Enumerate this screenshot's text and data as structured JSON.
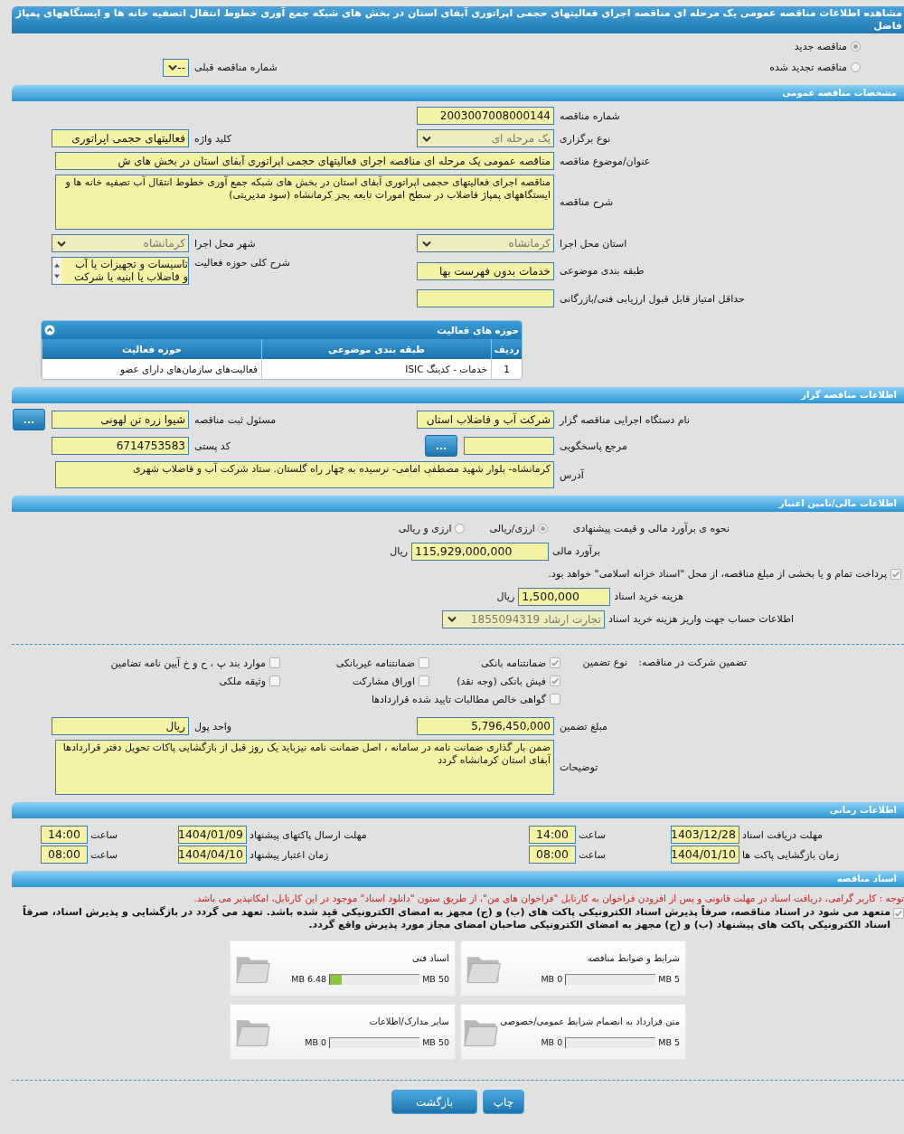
{
  "page_title": "مشاهده اطلاعات مناقصه عمومی یک مرحله ای مناقصه اجرای فعالیتهای حجمی اپراتوری آبفای استان در بخش های شبکه جمع آوری خطوط انتقال اتصفیه خانه ها و ایستگاههای پمپاژ فاضل",
  "tender_kind": [
    {
      "label": "مناقصه جدید",
      "selected": true
    },
    {
      "label": "مناقصه تجدید شده",
      "selected": false
    }
  ],
  "previous_tender": {
    "label": "شماره مناقصه قبلی",
    "value": "--",
    "kind": "select",
    "disabled": false
  },
  "general": {
    "title": "مشخصات مناقصه عمومی",
    "rows": [
      [
        {
          "label": "شماره مناقصه",
          "value": "2003007008000144",
          "kind": "text"
        }
      ],
      [
        {
          "label": "نوع برگزاری",
          "value": "یک مرحله ای",
          "kind": "select",
          "disabled": true
        },
        {
          "label": "کلید واژه",
          "value": "فعالیتهای حجمی اپراتوری",
          "kind": "text"
        }
      ],
      [
        {
          "label": "عنوان/موضوع مناقصه",
          "value": "مناقصه عمومی یک مرحله ای مناقصه اجرای فعالیتهای حجمی اپراتوری آبفای استان  در بخش های ش",
          "kind": "line"
        }
      ],
      [
        {
          "label": "شرح مناقصه",
          "value": "مناقصه اجرای فعالیتهای حجمی اپراتوری آبفای استان  در بخش های شبکه جمع آوری خطوط انتقال آب تصفیه خانه ها و ایستگاههای پمپاژ فاضلاب در سطح امورات تابعه بجز کرمانشاه (سود مدیریتی)",
          "kind": "memo"
        }
      ],
      [
        {
          "label": "استان محل اجرا",
          "value": "کرمانشاه",
          "kind": "select",
          "disabled": true
        },
        {
          "label": "شهر محل اجرا",
          "value": "کرمانشاه",
          "kind": "select",
          "disabled": true
        }
      ],
      [
        {
          "label": "طبقه بندی موضوعی",
          "value": "خدمات بدون فهرست بها",
          "kind": "text"
        },
        {
          "label": "شرح کلی حوزه فعالیت",
          "lines": [
            "تاسیسات و تجهیزات یا آب",
            "و فاضلاب یا ابنیه یا شرکت"
          ],
          "kind": "list"
        }
      ],
      [
        {
          "label": "حداقل امتیاز قابل قبول ارزیابی فنی/بازرگانی",
          "kind": "text"
        }
      ]
    ],
    "activity_table": {
      "title": "حوزه های فعالیت",
      "columns": [
        "ردیف",
        "طبقه بندی موضوعی",
        "حوزه فعالیت"
      ],
      "rows": [
        [
          "1",
          "خدمات - کدینگ ISIC",
          "فعالیت‌های سازمان‌های دارای عضو"
        ]
      ]
    }
  },
  "organizer": {
    "title": "اطلاعات مناقصه گزار",
    "rows": [
      [
        {
          "label": "نام دستگاه اجرایی مناقصه گزار",
          "value": "شرکت آب و فاضلاب استان",
          "kind": "text"
        },
        {
          "label": "مسئول ثبت مناقصه",
          "value": "شیوا زره تن لهونی",
          "kind": "text",
          "button": "..."
        }
      ],
      [
        {
          "label": "مرجع پاسخگویی",
          "kind": "text",
          "button": "..."
        },
        {
          "label": "کد پستی",
          "value": "6714753583",
          "kind": "text"
        }
      ],
      [
        {
          "label": "آدرس",
          "value": "کرمانشاه- بلوار شهید مصطفی امامی- نرسیده به چهار راه گلستان. ستاد شرکت  آب و فاضلاب شهری",
          "kind": "memo"
        }
      ]
    ]
  },
  "finance": {
    "title": "اطلاعات مالی/تامین اعتبار",
    "estimate_method": {
      "label": "نحوه ی برآورد مالی و قیمت پیشنهادی",
      "options": [
        {
          "label": "ارزی/ریالی",
          "selected": true
        },
        {
          "label": "ارزی و ریالی",
          "selected": false
        }
      ]
    },
    "estimate": {
      "label": "برآورد مالی",
      "value": "115,929,000,000",
      "unit": "ریال"
    },
    "treasury": {
      "label": "پرداخت تمام و یا بخشی از مبلغ مناقصه، از محل \"اسناد خزانه اسلامی\" خواهد بود.",
      "checked": true
    },
    "doc_fee": {
      "label": "هزینه خرید اسناد",
      "value": "1,500,000",
      "unit": "ریال"
    },
    "account": {
      "label": "اطلاعات حساب جهت واریز هزینه خرید اسناد",
      "value": "تجارت ارشاد 1855094319",
      "kind": "select",
      "disabled": true
    },
    "guarantee": {
      "title": "تضمین شرکت در مناقصه:",
      "type_label": "نوع تضمین",
      "options": [
        {
          "label": "ضمانتنامه بانکی",
          "checked": true
        },
        {
          "label": "ضمانتنامه غیربانکی",
          "checked": false
        },
        {
          "label": "موارد بند پ ، ح و خ آیین نامه تضامین",
          "checked": false
        },
        {
          "label": "فیش بانکی (وجه نقد)",
          "checked": true
        },
        {
          "label": "اوراق مشارکت",
          "checked": false
        },
        {
          "label": "وثیقه ملکی",
          "checked": false
        },
        {
          "label": "گواهی خالص مطالبات تایید شده قراردادها",
          "checked": false
        }
      ]
    },
    "rows": [
      [
        {
          "label": "مبلغ تضمین",
          "value": "5,796,450,000",
          "kind": "text"
        },
        {
          "label": "واحد پول",
          "value": "ریال",
          "kind": "text"
        }
      ],
      [
        {
          "label": "توضیحات",
          "value": "ضمن بار گذاری ضمانت نامه در سامانه ، اصل ضمانت نامه نیزباید یک روز قبل از بازگشایی پاکات تحویل دفتر قراردادها آبفای استان کرمانشاه گردد",
          "kind": "memo"
        }
      ]
    ]
  },
  "timing": {
    "title": "اطلاعات زمانی",
    "items": [
      {
        "label": "مهلت دریافت اسناد",
        "date": "1403/12/28",
        "time_label": "ساعت",
        "time": "14:00"
      },
      {
        "label": "مهلت ارسال پاکتهای پیشنهاد",
        "date": "1404/01/09",
        "time_label": "ساعت",
        "time": "14:00"
      },
      {
        "label": "زمان بازگشایی پاکت ها",
        "date": "1404/01/10",
        "time_label": "ساعت",
        "time": "08:00"
      },
      {
        "label": "زمان اعتبار پیشنهاد",
        "date": "1404/04/10",
        "time_label": "ساعت",
        "time": "08:00"
      }
    ]
  },
  "documents": {
    "title": "اسناد مناقصه",
    "notice": "توجه : کاربر گرامی، دریافت اسناد در مهلت قانونی و پس از افزودن فراخوان به کارتابل \"فراخوان های من\"، از طریق ستون \"دانلود اسناد\" موجود در این کارتابل، امکانپذیر می باشد.",
    "commitment": {
      "text": "متعهد می شود در اسناد مناقصه، صرفاً پذیرش اسناد الکترونیکی پاکت های (ب) و (ج) مجهز به امضای الکترونیکی قید شده باشد. تعهد می گردد در بازگشایی و پذیرش اسناد، صرفاً اسناد الکترونیکی پاکت های پیشنهاد (ب) و (ج) مجهز به امضای الکترونیکی صاحبان امضای مجاز مورد پذیرش واقع گردد.",
      "checked": true
    },
    "files": [
      {
        "name": "شرایط و ضوابط مناقصه",
        "max": "5 MB",
        "used": "0 MB",
        "level": 0
      },
      {
        "name": "اسناد فنی",
        "max": "50 MB",
        "used": "6.48 MB",
        "level": 0.13
      },
      {
        "name": "متن قرارداد به انضمام شرایط عمومی/خصوصی",
        "max": "5 MB",
        "used": "0 MB",
        "level": 0
      },
      {
        "name": "سایر مدارک/اطلاعات",
        "max": "50 MB",
        "used": "0 MB",
        "level": 0
      }
    ]
  },
  "buttons": [
    {
      "label": "چاپ"
    },
    {
      "label": "بازگشت"
    }
  ]
}
